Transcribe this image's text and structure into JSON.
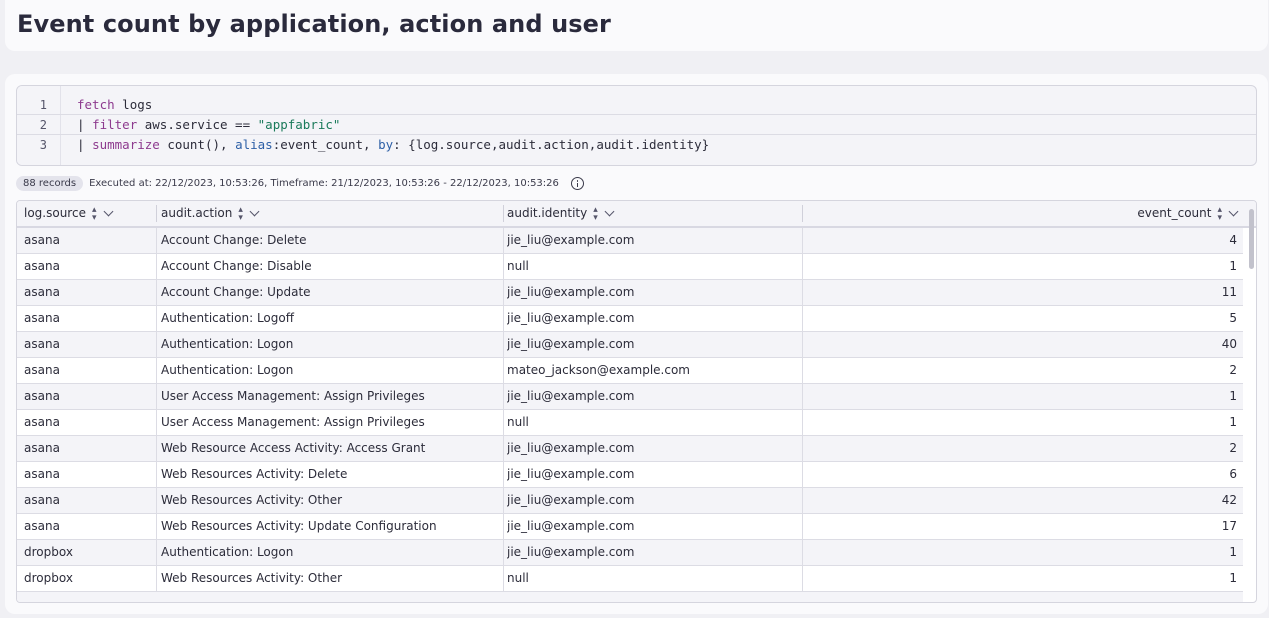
{
  "page": {
    "title": "Event count by application, action and user"
  },
  "editor": {
    "lines": [
      {
        "number": "1",
        "tokens": [
          {
            "t": "fetch",
            "c": "kw"
          },
          {
            "t": " logs",
            "c": "fn"
          }
        ]
      },
      {
        "number": "2",
        "tokens": [
          {
            "t": "| ",
            "c": "fn"
          },
          {
            "t": "filter",
            "c": "kw"
          },
          {
            "t": " aws.service == ",
            "c": "fn"
          },
          {
            "t": "\"appfabric\"",
            "c": "str"
          }
        ]
      },
      {
        "number": "3",
        "tokens": [
          {
            "t": "| ",
            "c": "fn"
          },
          {
            "t": "summarize",
            "c": "kw"
          },
          {
            "t": " count(), ",
            "c": "fn"
          },
          {
            "t": "alias",
            "c": "param"
          },
          {
            "t": ":event_count, ",
            "c": "fn"
          },
          {
            "t": "by",
            "c": "param"
          },
          {
            "t": ": {log.source,audit.action,audit.identity}",
            "c": "fn"
          }
        ]
      }
    ]
  },
  "status": {
    "records": "88 records",
    "executed": "Executed at: 22/12/2023, 10:53:26, Timeframe: 21/12/2023, 10:53:26 - 22/12/2023, 10:53:26",
    "info_icon": "info-icon"
  },
  "table": {
    "columns": [
      "log.source",
      "audit.action",
      "audit.identity",
      "event_count"
    ],
    "rows": [
      [
        "asana",
        "Account Change: Delete",
        "jie_liu@example.com",
        "4"
      ],
      [
        "asana",
        "Account Change: Disable",
        "null",
        "1"
      ],
      [
        "asana",
        "Account Change: Update",
        "jie_liu@example.com",
        "11"
      ],
      [
        "asana",
        "Authentication: Logoff",
        "jie_liu@example.com",
        "5"
      ],
      [
        "asana",
        "Authentication: Logon",
        "jie_liu@example.com",
        "40"
      ],
      [
        "asana",
        "Authentication: Logon",
        "mateo_jackson@example.com",
        "2"
      ],
      [
        "asana",
        "User Access Management: Assign Privileges",
        "jie_liu@example.com",
        "1"
      ],
      [
        "asana",
        "User Access Management: Assign Privileges",
        "null",
        "1"
      ],
      [
        "asana",
        "Web Resource Access Activity: Access Grant",
        "jie_liu@example.com",
        "2"
      ],
      [
        "asana",
        "Web Resources Activity: Delete",
        "jie_liu@example.com",
        "6"
      ],
      [
        "asana",
        "Web Resources Activity: Other",
        "jie_liu@example.com",
        "42"
      ],
      [
        "asana",
        "Web Resources Activity: Update Configuration",
        "jie_liu@example.com",
        "17"
      ],
      [
        "dropbox",
        "Authentication: Logon",
        "jie_liu@example.com",
        "1"
      ],
      [
        "dropbox",
        "Web Resources Activity: Other",
        "null",
        "1"
      ]
    ]
  }
}
